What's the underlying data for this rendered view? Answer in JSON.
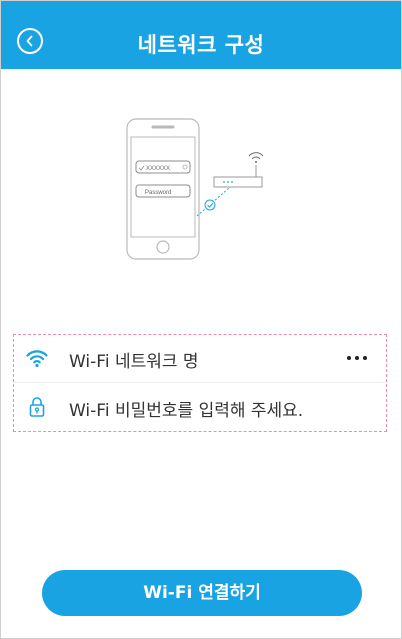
{
  "header": {
    "title": "네트워크 구성",
    "back_icon": "chevron-left-circle-icon"
  },
  "illustration": {
    "ssid_field": "XXXXXX",
    "password_field": "Password"
  },
  "form": {
    "network_name_label": "Wi-Fi 네트워크 명",
    "password_placeholder": "Wi-Fi 비밀번호를 입력해 주세요.",
    "wifi_icon": "wifi-icon",
    "lock_icon": "lock-icon",
    "more_icon": "more-horizontal-icon"
  },
  "footer": {
    "connect_label": "Wi-Fi 연결하기"
  },
  "colors": {
    "accent": "#1aa3e3",
    "dashed_outline": "#f08ab0"
  }
}
